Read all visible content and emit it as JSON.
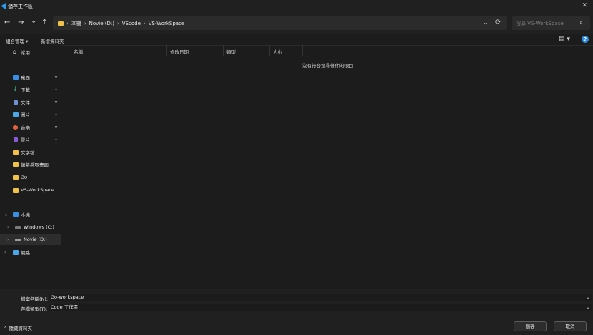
{
  "window": {
    "title": "儲存工作區",
    "close": "✕"
  },
  "nav": {
    "back": "←",
    "forward": "→",
    "recent": "⌄",
    "up": "↑",
    "refresh": "⟳",
    "dropdown": "⌄"
  },
  "breadcrumb": [
    "本機",
    "Novie (D:)",
    "VScode",
    "VS-WorkSpace"
  ],
  "search": {
    "placeholder": "搜尋 VS-WorkSpace"
  },
  "toolbar": {
    "organize": "組合管理 ▾",
    "new_folder": "新增資料夾"
  },
  "sidebar": {
    "home": "常用",
    "pinned": [
      {
        "label": "桌面",
        "color": "#3a8ee6"
      },
      {
        "label": "下載",
        "color": "#3fb37a"
      },
      {
        "label": "文件",
        "color": "#6f8fd8"
      },
      {
        "label": "圖片",
        "color": "#4aa8e8"
      },
      {
        "label": "音樂",
        "color": "#e0623a"
      },
      {
        "label": "影片",
        "color": "#8a5bd6"
      }
    ],
    "folders": [
      "文字檔",
      "螢幕擷取畫面",
      "Go",
      "VS-WorkSpace"
    ],
    "this_pc": "本機",
    "drives": [
      "Windows (C:)",
      "Novie (D:)"
    ],
    "network": "網路"
  },
  "columns": [
    "名稱",
    "修改日期",
    "類型",
    "大小"
  ],
  "empty_message": "沒有符合搜尋條件的項目",
  "form": {
    "filename_label": "檔案名稱(N):",
    "filename_value": "Go-workspace",
    "filetype_label": "存檔類型(T):",
    "filetype_value": "Code 工作區"
  },
  "footer": {
    "hide_folders": "隱藏資料夾",
    "save": "儲存",
    "cancel": "取消"
  }
}
